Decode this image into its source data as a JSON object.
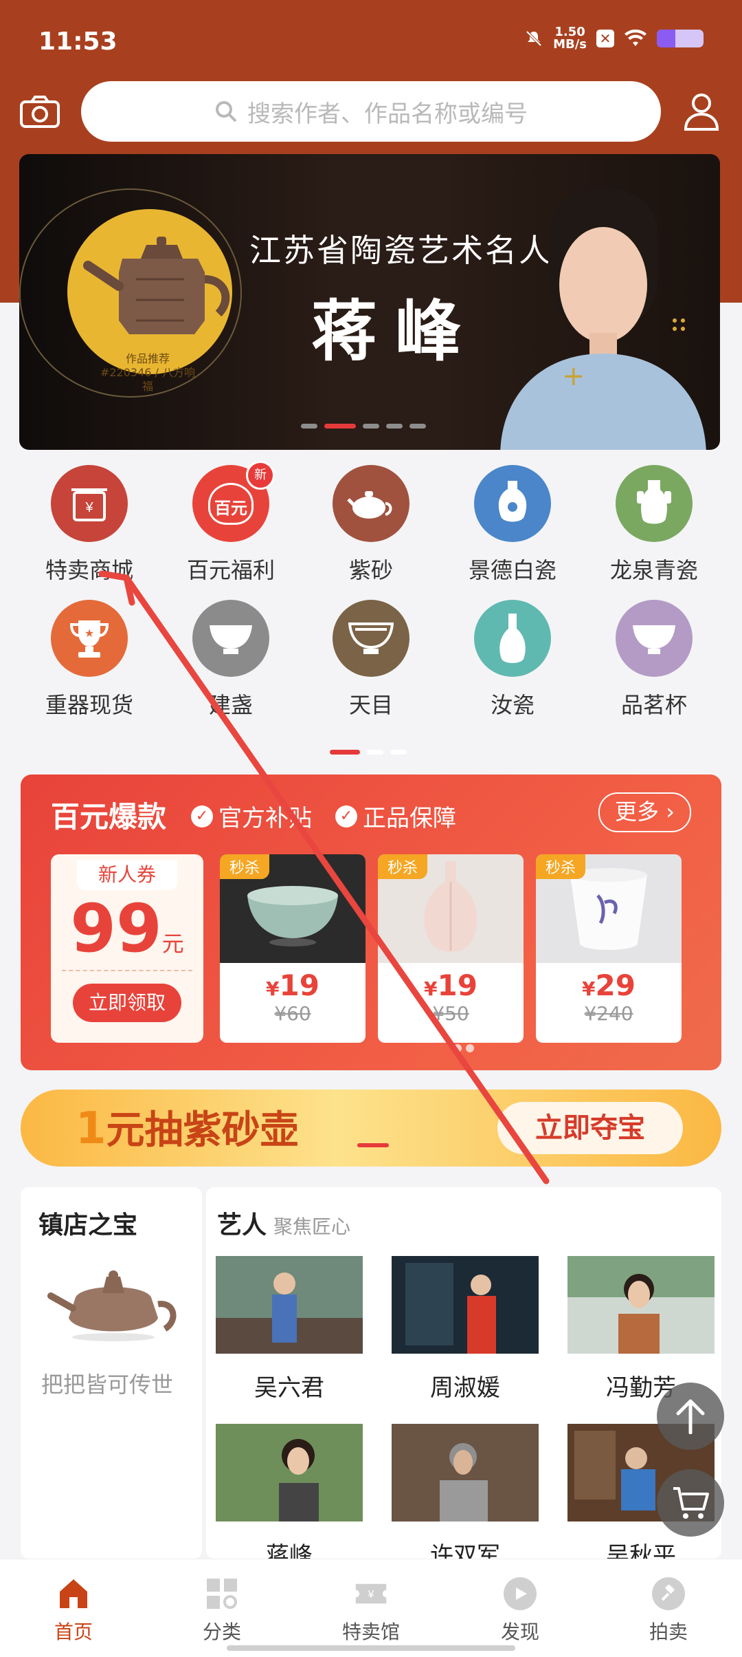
{
  "status": {
    "time": "11:53",
    "speed_value": "1.50",
    "speed_unit": "MB/s"
  },
  "search": {
    "placeholder": "搜索作者、作品名称或编号"
  },
  "banner": {
    "subtitle": "江苏省陶瓷艺术名人",
    "name": "蒋峰",
    "rec_line1": "作品推荐",
    "rec_line2": "#220346 / 八方响福"
  },
  "categories": [
    {
      "label": "特卖商城",
      "icon": "shop-sign-icon",
      "color": "#c7443a"
    },
    {
      "label": "百元福利",
      "icon": "hundred-yuan-icon",
      "color": "#e8433a",
      "badge": "新",
      "icon_text": "百元"
    },
    {
      "label": "紫砂",
      "icon": "teapot-icon",
      "color": "#a0523e"
    },
    {
      "label": "景德白瓷",
      "icon": "vase-blue-icon",
      "color": "#4a86c9"
    },
    {
      "label": "龙泉青瓷",
      "icon": "vase-green-icon",
      "color": "#7aa860"
    },
    {
      "label": "重器现货",
      "icon": "trophy-icon",
      "color": "#e46a3a"
    },
    {
      "label": "建盏",
      "icon": "bowl-gray-icon",
      "color": "#8b8b8b"
    },
    {
      "label": "天目",
      "icon": "bowl-brown-icon",
      "color": "#7b6347"
    },
    {
      "label": "汝瓷",
      "icon": "vase-teal-icon",
      "color": "#5fb9b0"
    },
    {
      "label": "品茗杯",
      "icon": "cup-lavender-icon",
      "color": "#b39bc6"
    }
  ],
  "promo": {
    "title": "百元爆款",
    "tag1": "官方补贴",
    "tag2": "正品保障",
    "more": "更多",
    "coupon": {
      "head": "新人券",
      "amount": "99",
      "unit": "元",
      "button": "立即领取"
    },
    "products": [
      {
        "flag": "秒杀",
        "currency": "¥",
        "price": "19",
        "old": "¥60"
      },
      {
        "flag": "秒杀",
        "currency": "¥",
        "price": "19",
        "old": "¥50"
      },
      {
        "flag": "秒杀",
        "currency": "¥",
        "price": "29",
        "old": "¥240"
      }
    ]
  },
  "lottery": {
    "text_num": "1",
    "text": "元抽紫砂壶",
    "cta": "立即夺宝"
  },
  "treasure": {
    "title": "镇店之宝",
    "caption": "把把皆可传世"
  },
  "artists": {
    "title": "艺人",
    "subtitle": "聚焦匠心",
    "items": [
      {
        "name": "吴六君"
      },
      {
        "name": "周淑媛"
      },
      {
        "name": "冯勤芳"
      },
      {
        "name": "蒋峰"
      },
      {
        "name": "许双军"
      },
      {
        "name": "吴秋平"
      }
    ]
  },
  "tabs": [
    {
      "label": "首页",
      "icon": "home-icon"
    },
    {
      "label": "分类",
      "icon": "category-icon"
    },
    {
      "label": "特卖馆",
      "icon": "sale-ticket-icon"
    },
    {
      "label": "发现",
      "icon": "play-icon"
    },
    {
      "label": "拍卖",
      "icon": "auction-hammer-icon"
    }
  ]
}
